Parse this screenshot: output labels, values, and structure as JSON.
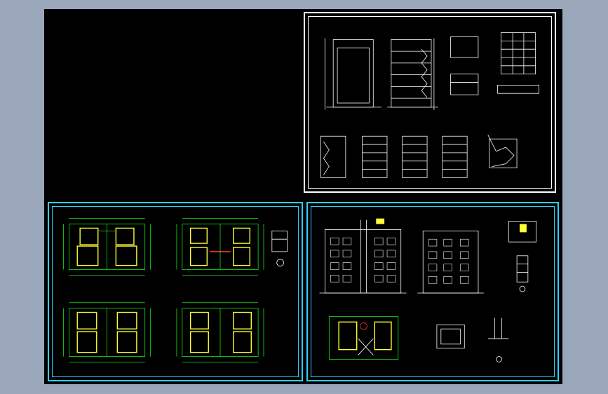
{
  "window": {
    "background": "#9aa7bb",
    "canvas_color": "#000000"
  },
  "sheets": [
    {
      "id": "elevations-sections",
      "frame_color": "#ffffff",
      "drawing_color": "#ffffff"
    },
    {
      "id": "floor-plans",
      "frame_color": "#30d0ff",
      "drawing_color": "#19e619",
      "wall_color": "#ffff33"
    },
    {
      "id": "elevations-details",
      "frame_color": "#30d0ff",
      "drawing_color": "#ffffff"
    }
  ]
}
